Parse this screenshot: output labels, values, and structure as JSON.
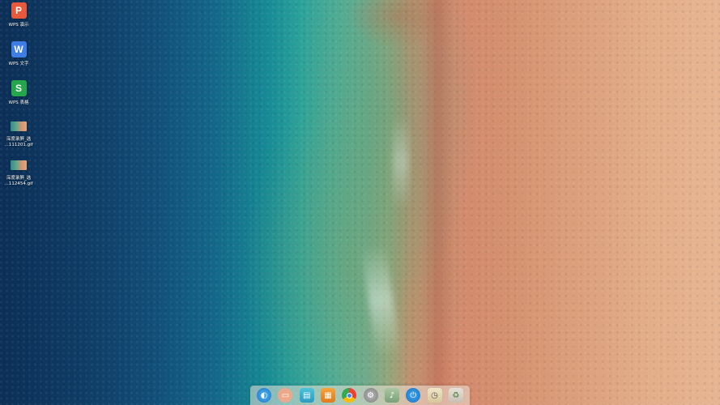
{
  "desktop": {
    "icons": [
      {
        "label": "WPS 演示",
        "glyph": "P"
      },
      {
        "label": "WPS 文字",
        "glyph": "W"
      },
      {
        "label": "WPS 表格",
        "glyph": "S"
      },
      {
        "label_line1": "深度录屏_选",
        "label_line2": "…111201.gif"
      },
      {
        "label_line1": "深度录屏_选",
        "label_line2": "…112454.gif"
      }
    ]
  },
  "dock": {
    "items": [
      {
        "icon": "launcher-icon",
        "glyph": "◐"
      },
      {
        "icon": "multitask-view-icon",
        "glyph": "▭"
      },
      {
        "icon": "file-manager-icon",
        "glyph": "▤"
      },
      {
        "icon": "app-store-icon",
        "glyph": "▦"
      },
      {
        "icon": "chrome-icon",
        "glyph": "◉"
      },
      {
        "icon": "settings-icon",
        "glyph": "⚙"
      },
      {
        "icon": "deepin-music-icon",
        "glyph": "♪"
      },
      {
        "icon": "power-icon",
        "glyph": "⏻"
      },
      {
        "icon": "clock-icon",
        "glyph": "◷"
      },
      {
        "icon": "trash-icon",
        "glyph": "♻"
      }
    ]
  },
  "colors": {
    "wps_presentation": "#e8593b",
    "wps_writer": "#3e7ce6",
    "wps_spreadsheet": "#25a64a"
  }
}
